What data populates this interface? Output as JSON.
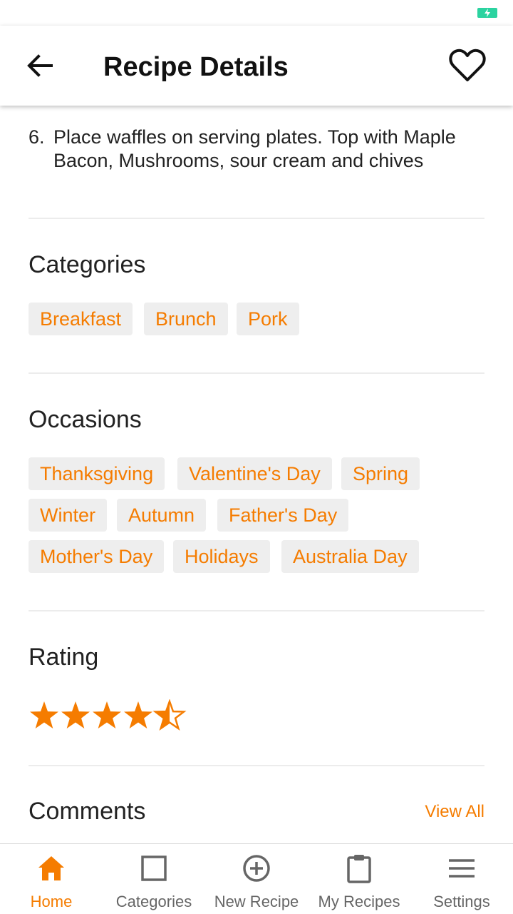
{
  "header": {
    "title": "Recipe Details"
  },
  "steps": [
    {
      "number": "6.",
      "text": "Place waffles on serving plates. Top with Maple Bacon, Mushrooms, sour cream and chives"
    }
  ],
  "categories": {
    "title": "Categories",
    "items": [
      "Breakfast",
      "Brunch",
      "Pork"
    ]
  },
  "occasions": {
    "title": "Occasions",
    "items": [
      "Thanksgiving",
      "Valentine's Day",
      "Spring",
      "Winter",
      "Autumn",
      "Father's Day",
      "Mother's Day",
      "Holidays",
      "Australia Day"
    ]
  },
  "rating": {
    "title": "Rating",
    "value": 4.5,
    "max": 5
  },
  "comments": {
    "title": "Comments",
    "view_all": "View All"
  },
  "bottom_nav": [
    {
      "label": "Home",
      "icon": "home-icon",
      "active": true
    },
    {
      "label": "Categories",
      "icon": "square-icon",
      "active": false
    },
    {
      "label": "New Recipe",
      "icon": "plus-circle-icon",
      "active": false
    },
    {
      "label": "My Recipes",
      "icon": "clipboard-icon",
      "active": false
    },
    {
      "label": "Settings",
      "icon": "menu-icon",
      "active": false
    }
  ],
  "colors": {
    "accent": "#f57c00",
    "chip_bg": "#eeeeee",
    "battery": "#2bd3a0"
  }
}
